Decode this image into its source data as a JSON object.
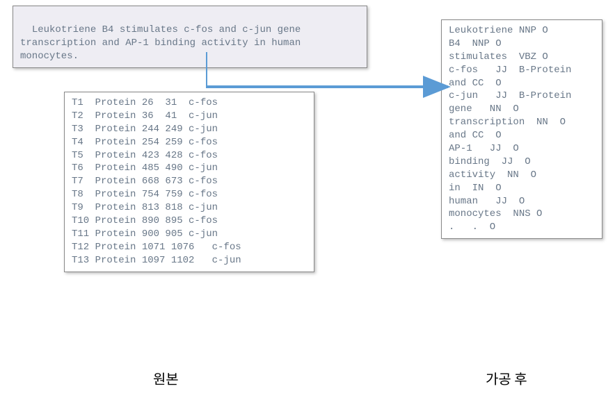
{
  "source_text": "Leukotriene B4 stimulates c-fos and c-jun gene\ntranscription and AP-1 binding activity in human\nmonocytes.",
  "annotations": [
    {
      "id": "T1",
      "type": "Protein",
      "start": "26",
      "end": "31",
      "token": "c-fos"
    },
    {
      "id": "T2",
      "type": "Protein",
      "start": "36",
      "end": "41",
      "token": "c-jun"
    },
    {
      "id": "T3",
      "type": "Protein",
      "start": "244",
      "end": "249",
      "token": "c-jun"
    },
    {
      "id": "T4",
      "type": "Protein",
      "start": "254",
      "end": "259",
      "token": "c-fos"
    },
    {
      "id": "T5",
      "type": "Protein",
      "start": "423",
      "end": "428",
      "token": "c-fos"
    },
    {
      "id": "T6",
      "type": "Protein",
      "start": "485",
      "end": "490",
      "token": "c-jun"
    },
    {
      "id": "T7",
      "type": "Protein",
      "start": "668",
      "end": "673",
      "token": "c-fos"
    },
    {
      "id": "T8",
      "type": "Protein",
      "start": "754",
      "end": "759",
      "token": "c-fos"
    },
    {
      "id": "T9",
      "type": "Protein",
      "start": "813",
      "end": "818",
      "token": "c-jun"
    },
    {
      "id": "T10",
      "type": "Protein",
      "start": "890",
      "end": "895",
      "token": "c-fos"
    },
    {
      "id": "T11",
      "type": "Protein",
      "start": "900",
      "end": "905",
      "token": "c-jun"
    },
    {
      "id": "T12",
      "type": "Protein",
      "start": "1071",
      "end": "1076",
      "token": "c-fos"
    },
    {
      "id": "T13",
      "type": "Protein",
      "start": "1097",
      "end": "1102",
      "token": "c-jun"
    }
  ],
  "output_tokens": [
    {
      "word": "Leukotriene",
      "pos": "NNP",
      "tag": "O"
    },
    {
      "word": "B4",
      "pos": "NNP",
      "tag": "O"
    },
    {
      "word": "stimulates",
      "pos": "VBZ",
      "tag": "O"
    },
    {
      "word": "c-fos",
      "pos": "JJ",
      "tag": "B-Protein"
    },
    {
      "word": "and",
      "pos": "CC",
      "tag": "O"
    },
    {
      "word": "c-jun",
      "pos": "JJ",
      "tag": "B-Protein"
    },
    {
      "word": "gene",
      "pos": "NN",
      "tag": "O"
    },
    {
      "word": "transcription",
      "pos": "NN",
      "tag": "O"
    },
    {
      "word": "and",
      "pos": "CC",
      "tag": "O"
    },
    {
      "word": "AP-1",
      "pos": "JJ",
      "tag": "O"
    },
    {
      "word": "binding",
      "pos": "JJ",
      "tag": "O"
    },
    {
      "word": "activity",
      "pos": "NN",
      "tag": "O"
    },
    {
      "word": "in",
      "pos": "IN",
      "tag": "O"
    },
    {
      "word": "human",
      "pos": "JJ",
      "tag": "O"
    },
    {
      "word": "monocytes",
      "pos": "NNS",
      "tag": "O"
    },
    {
      "word": ".",
      "pos": ".",
      "tag": "O"
    }
  ],
  "labels": {
    "left": "원본",
    "right": "가공 후"
  },
  "colors": {
    "arrow": "#5b9bd5"
  }
}
